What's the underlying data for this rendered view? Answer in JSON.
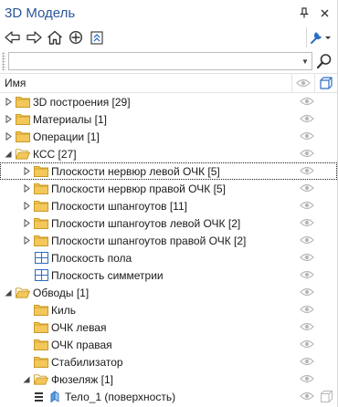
{
  "app": {
    "title": "3D Модель"
  },
  "search": {
    "value": "",
    "placeholder": ""
  },
  "header": {
    "name_label": "Имя"
  },
  "tree": [
    {
      "label": "3D построения [29]",
      "level": 0,
      "expander": "collapsed",
      "icon": "folder-icon"
    },
    {
      "label": "Материалы [1]",
      "level": 0,
      "expander": "collapsed",
      "icon": "folder-icon"
    },
    {
      "label": "Операции [1]",
      "level": 0,
      "expander": "collapsed",
      "icon": "folder-icon"
    },
    {
      "label": "КСС [27]",
      "level": 0,
      "expander": "expanded",
      "icon": "folder-open-icon"
    },
    {
      "label": "Плоскости нервюр левой ОЧК [5]",
      "level": 1,
      "expander": "collapsed",
      "icon": "folder-icon",
      "focused": true
    },
    {
      "label": "Плоскости нервюр правой ОЧК [5]",
      "level": 1,
      "expander": "collapsed",
      "icon": "folder-icon"
    },
    {
      "label": "Плоскости шпангоутов [11]",
      "level": 1,
      "expander": "collapsed",
      "icon": "folder-icon"
    },
    {
      "label": "Плоскости шпангоутов левой ОЧК [2]",
      "level": 1,
      "expander": "collapsed",
      "icon": "folder-icon"
    },
    {
      "label": "Плоскости шпангоутов правой ОЧК [2]",
      "level": 1,
      "expander": "collapsed",
      "icon": "folder-icon"
    },
    {
      "label": "Плоскость пола",
      "level": 1,
      "expander": "none",
      "icon": "plane-grid-icon"
    },
    {
      "label": "Плоскость симметрии",
      "level": 1,
      "expander": "none",
      "icon": "plane-grid-icon"
    },
    {
      "label": "Обводы [1]",
      "level": 0,
      "expander": "expanded",
      "icon": "folder-open-icon"
    },
    {
      "label": "Киль",
      "level": 1,
      "expander": "none",
      "icon": "folder-icon"
    },
    {
      "label": "ОЧК левая",
      "level": 1,
      "expander": "none",
      "icon": "folder-icon"
    },
    {
      "label": "ОЧК правая",
      "level": 1,
      "expander": "none",
      "icon": "folder-icon"
    },
    {
      "label": "Стабилизатор",
      "level": 1,
      "expander": "none",
      "icon": "folder-icon"
    },
    {
      "label": "Фюзеляж [1]",
      "level": 1,
      "expander": "expanded",
      "icon": "folder-open-icon"
    },
    {
      "label": "Тело_1 (поверхность)",
      "level": 2,
      "expander": "none",
      "icon": "surface-body-icon",
      "menu": true,
      "box3d": true
    }
  ],
  "colors": {
    "title": "#2b5797",
    "folder": "#e8b93c",
    "plane": "#2f6fc0",
    "eye": "#b8b8b8"
  }
}
